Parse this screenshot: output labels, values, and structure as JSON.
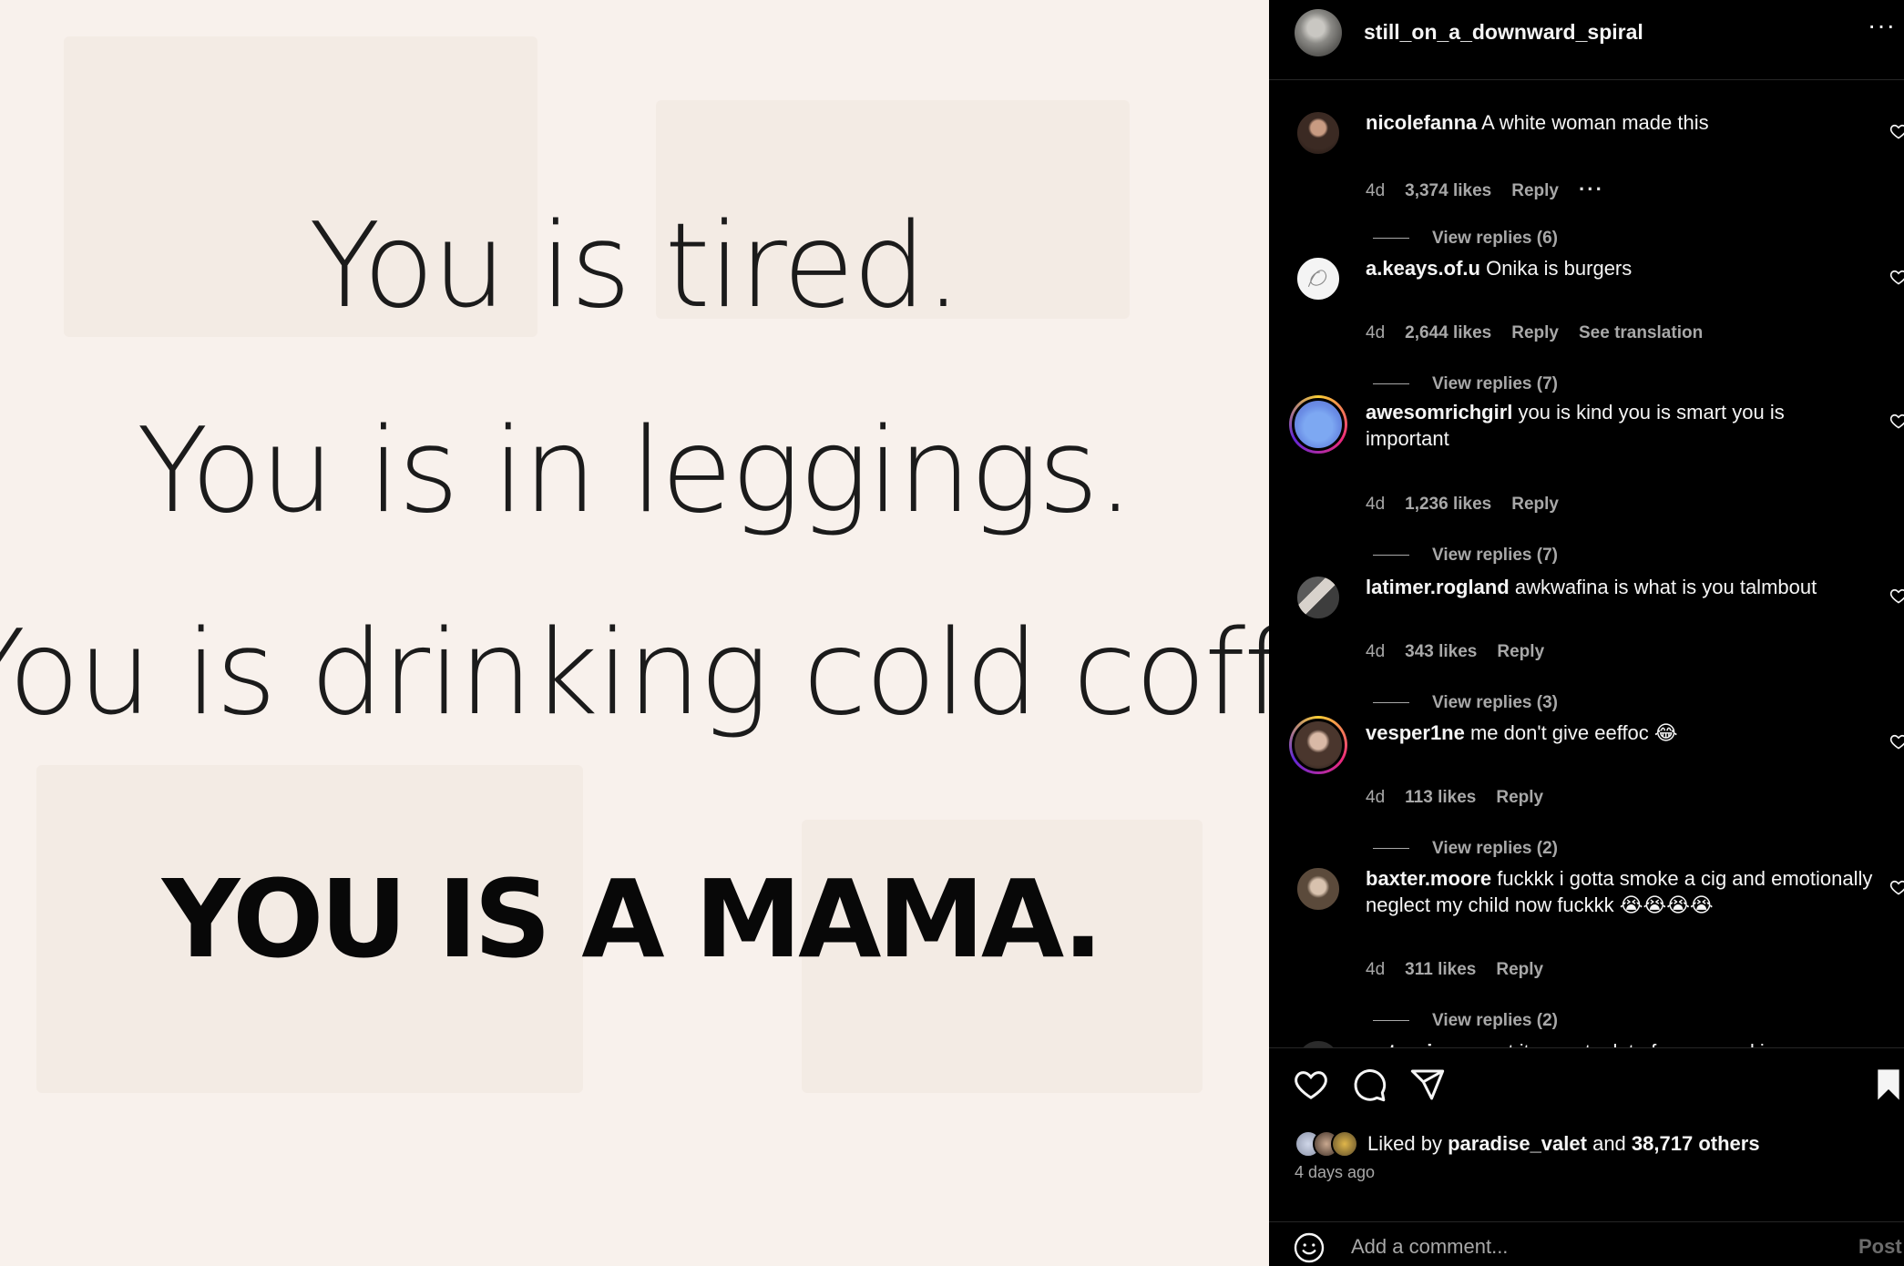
{
  "post": {
    "image_lines": [
      "You is tired.",
      "You is in leggings.",
      "You is drinking cold coffee.",
      "YOU IS A MAMA."
    ]
  },
  "header": {
    "username": "still_on_a_downward_spiral",
    "more_label": "···"
  },
  "comments": [
    {
      "user": "nicolefanna",
      "text": "A white woman made this",
      "age": "4d",
      "likes": "3,374 likes",
      "reply": "Reply",
      "extra": "···",
      "view_replies": "View replies (6)"
    },
    {
      "user": "a.keays.of.u",
      "text": "Onika is burgers",
      "age": "4d",
      "likes": "2,644 likes",
      "reply": "Reply",
      "extra": "See translation",
      "view_replies": "View replies (7)"
    },
    {
      "user": "awesomrichgirl",
      "text": "you is kind you is smart you is important",
      "age": "4d",
      "likes": "1,236 likes",
      "reply": "Reply",
      "view_replies": "View replies (7)"
    },
    {
      "user": "latimer.rogland",
      "text": "awkwafina is what is you talmbout",
      "age": "4d",
      "likes": "343 likes",
      "reply": "Reply",
      "view_replies": "View replies (3)"
    },
    {
      "user": "vesper1ne",
      "text": "me don't give eeffoc 😂",
      "age": "4d",
      "likes": "113 likes",
      "reply": "Reply",
      "view_replies": "View replies (2)"
    },
    {
      "user": "baxter.moore",
      "text": "fuckkk i gotta smoke a cig and emotionally neglect my child now fuckkk 😭😭😭😭",
      "age": "4d",
      "likes": "311 likes",
      "reply": "Reply",
      "view_replies": "View replies (2)"
    },
    {
      "user": "patocri",
      "text": "me want it no pot a lot of sense and is"
    }
  ],
  "likes": {
    "prefix": "Liked by",
    "user": "paradise_valet",
    "and": "and",
    "others": "38,717 others",
    "date": "4 days ago"
  },
  "comment_box": {
    "placeholder": "Add a comment...",
    "post_label": "Post"
  },
  "colors": {
    "background": "#000000",
    "text": "#f5f5f5",
    "secondary": "#a8a8a8",
    "image_bg": "#f8f1ec"
  },
  "icons": {
    "actions": [
      "heart-icon",
      "comment-icon",
      "share-icon",
      "bookmark-icon"
    ],
    "comment_like": "heart-outline-icon",
    "emoji": "smiley-icon"
  }
}
